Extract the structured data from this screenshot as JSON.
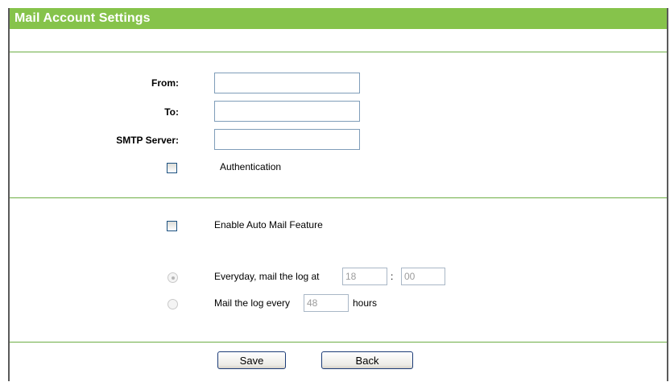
{
  "header": {
    "title": "Mail Account Settings"
  },
  "account": {
    "from_label": "From:",
    "from_value": "",
    "to_label": "To:",
    "to_value": "",
    "smtp_label": "SMTP Server:",
    "smtp_value": "",
    "authentication_label": "Authentication",
    "authentication_checked": false
  },
  "auto_mail": {
    "enable_label": "Enable Auto Mail Feature",
    "enabled": false,
    "everyday_label": "Everyday, mail the log at",
    "everyday_selected": true,
    "hour_value": "18",
    "colon": ":",
    "minute_value": "00",
    "every_label": "Mail the log every",
    "every_selected": false,
    "hours_value": "48",
    "hours_unit": "hours"
  },
  "actions": {
    "save_label": "Save",
    "back_label": "Back"
  },
  "colors": {
    "accent": "#86c34b",
    "rule": "#6dae44",
    "title_text": "#ffffff"
  }
}
